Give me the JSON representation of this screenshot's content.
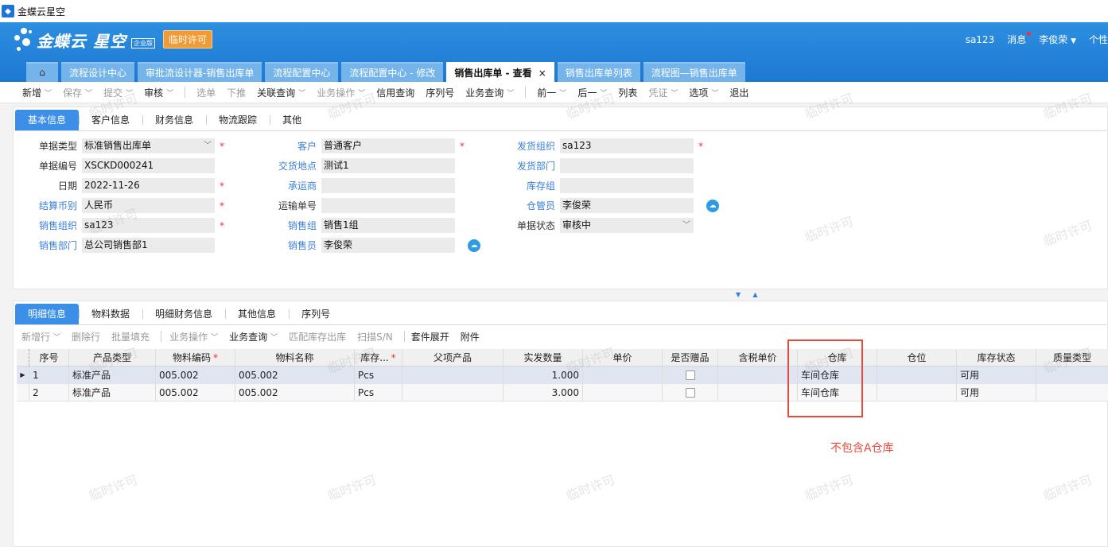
{
  "window": {
    "title": "金蝶云星空"
  },
  "header": {
    "brand": "金蝶云 星空",
    "edition": "企业版",
    "temp_license": "临时许可",
    "user_code": "sa123",
    "messages": "消息",
    "user_name": "李俊荣",
    "personal": "个性"
  },
  "tabs": [
    {
      "label": "流程设计中心"
    },
    {
      "label": "审批流设计器-销售出库单"
    },
    {
      "label": "流程配置中心"
    },
    {
      "label": "流程配置中心 - 修改"
    },
    {
      "label": "销售出库单 - 查看",
      "active": true,
      "close": "×"
    },
    {
      "label": "销售出库单列表"
    },
    {
      "label": "流程图—销售出库单"
    }
  ],
  "toolbar": [
    {
      "label": "新增",
      "caret": true
    },
    {
      "label": "保存",
      "caret": true,
      "disabled": true
    },
    {
      "label": "提交",
      "caret": true,
      "disabled": true
    },
    {
      "label": "审核",
      "caret": true
    },
    {
      "label": "选单",
      "disabled": true
    },
    {
      "label": "下推",
      "disabled": true
    },
    {
      "label": "关联查询",
      "caret": true
    },
    {
      "label": "业务操作",
      "caret": true,
      "disabled": true
    },
    {
      "label": "信用查询"
    },
    {
      "label": "序列号"
    },
    {
      "label": "业务查询",
      "caret": true
    },
    {
      "label": "前一",
      "caret": true
    },
    {
      "label": "后一",
      "caret": true
    },
    {
      "label": "列表"
    },
    {
      "label": "凭证",
      "caret": true,
      "disabled": true
    },
    {
      "label": "选项",
      "caret": true
    },
    {
      "label": "退出"
    }
  ],
  "header_tabs": [
    "基本信息",
    "客户信息",
    "财务信息",
    "物流跟踪",
    "其他"
  ],
  "fields": {
    "bill_type": {
      "label": "单据类型",
      "value": "标准销售出库单"
    },
    "bill_no": {
      "label": "单据编号",
      "value": "XSCKD000241"
    },
    "date": {
      "label": "日期",
      "value": "2022-11-26"
    },
    "currency": {
      "label": "结算币别",
      "value": "人民币"
    },
    "sale_org": {
      "label": "销售组织",
      "value": "sa123"
    },
    "sale_dept": {
      "label": "销售部门",
      "value": "总公司销售部1"
    },
    "customer": {
      "label": "客户",
      "value": "普通客户"
    },
    "delivery_place": {
      "label": "交货地点",
      "value": "测试1"
    },
    "carrier": {
      "label": "承运商",
      "value": ""
    },
    "ship_no": {
      "label": "运输单号",
      "value": ""
    },
    "sale_group": {
      "label": "销售组",
      "value": "销售1组"
    },
    "salesman": {
      "label": "销售员",
      "value": "李俊荣"
    },
    "ship_org": {
      "label": "发货组织",
      "value": "sa123"
    },
    "ship_dept": {
      "label": "发货部门",
      "value": ""
    },
    "stock_group": {
      "label": "库存组",
      "value": ""
    },
    "stock_keeper": {
      "label": "仓管员",
      "value": "李俊荣"
    },
    "bill_status": {
      "label": "单据状态",
      "value": "审核中"
    }
  },
  "detail_tabs": [
    "明细信息",
    "物料数据",
    "明细财务信息",
    "其他信息",
    "序列号"
  ],
  "detail_toolbar": [
    {
      "label": "新增行",
      "caret": true,
      "disabled": true
    },
    {
      "label": "删除行",
      "disabled": true
    },
    {
      "label": "批量填充",
      "disabled": true
    },
    {
      "label": "业务操作",
      "caret": true,
      "disabled": true
    },
    {
      "label": "业务查询",
      "caret": true
    },
    {
      "label": "匹配库存出库",
      "disabled": true
    },
    {
      "label": "扫描S/N",
      "disabled": true
    },
    {
      "label": "套件展开"
    },
    {
      "label": "附件"
    }
  ],
  "grid": {
    "columns": [
      "序号",
      "产品类型",
      "物料编码",
      "物料名称",
      "库存...",
      "父项产品",
      "实发数量",
      "单价",
      "是否赠品",
      "含税单价",
      "仓库",
      "仓位",
      "库存状态",
      "质量类型"
    ],
    "rows": [
      {
        "seq": "1",
        "ptype": "标准产品",
        "code": "005.002",
        "name": "005.002",
        "unit": "Pcs",
        "parent": "",
        "qty": "1.000",
        "price": "",
        "warehouse": "车间仓库",
        "loc": "",
        "status": "可用",
        "quality": ""
      },
      {
        "seq": "2",
        "ptype": "标准产品",
        "code": "005.002",
        "name": "005.002",
        "unit": "Pcs",
        "parent": "",
        "qty": "3.000",
        "price": "",
        "warehouse": "车间仓库",
        "loc": "",
        "status": "可用",
        "quality": ""
      }
    ]
  },
  "watermark": "临时许可",
  "annotation": {
    "text": "不包含A仓库"
  },
  "colors": {
    "header": "#1d78d2",
    "accent": "#3b8fe6",
    "annotation": "#e64a3b",
    "license": "#f29b35"
  }
}
